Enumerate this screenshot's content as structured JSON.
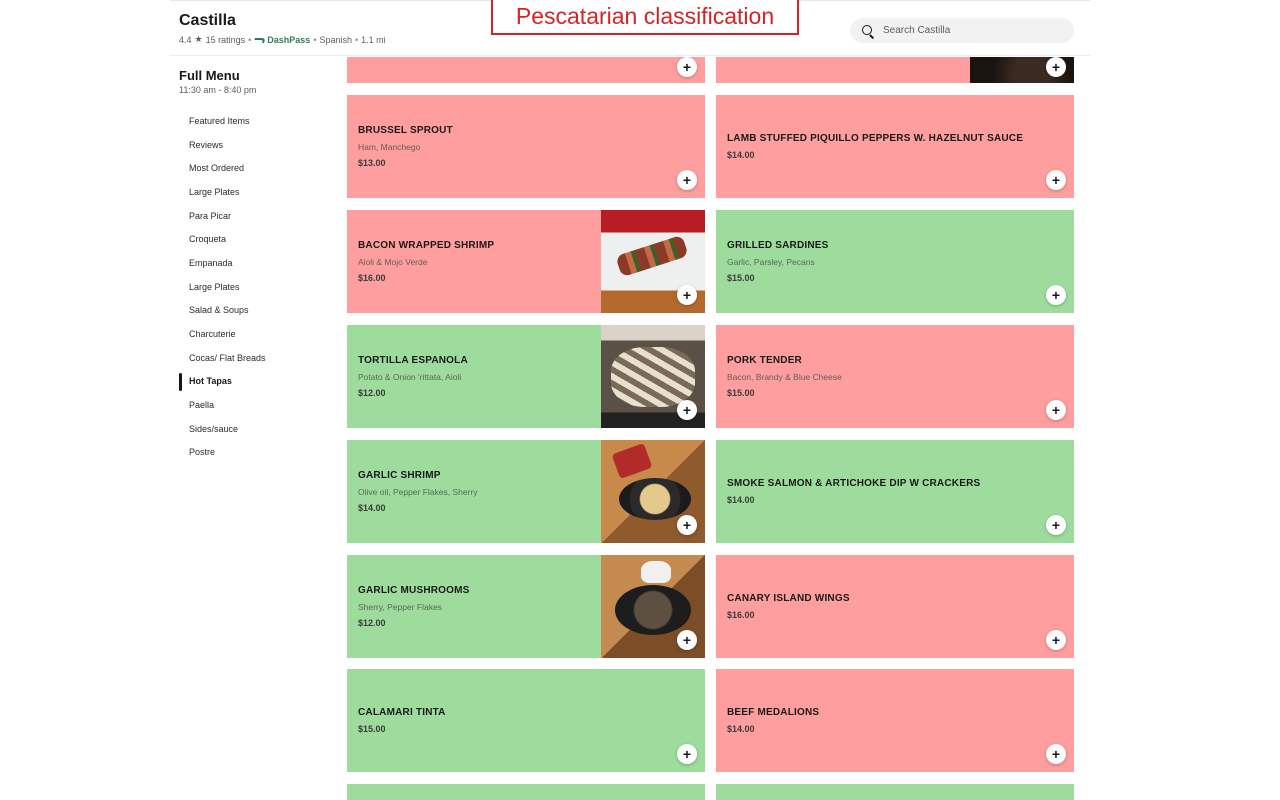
{
  "annotation": "Pescatarian classification",
  "store": {
    "name": "Castilla",
    "rating": "4.4",
    "ratings_count": "15 ratings",
    "dashpass": "DashPass",
    "cuisine": "Spanish",
    "distance": "1.1 mi"
  },
  "search": {
    "placeholder": "Search Castilla"
  },
  "menu": {
    "title": "Full Menu",
    "hours": "11:30 am - 8:40 pm",
    "items": [
      "Featured Items",
      "Reviews",
      "Most Ordered",
      "Large Plates",
      "Para Picar",
      "Croqueta",
      "Empanada",
      "Large Plates",
      "Salad & Soups",
      "Charcuterie",
      "Cocas/ Flat Breads",
      "Hot Tapas",
      "Paella",
      "Sides/sauce",
      "Postre"
    ],
    "active": "Hot Tapas"
  },
  "colors": {
    "non_pescatarian": "#ff9e9e",
    "pescatarian": "#9ddc9d",
    "annotation": "#d42426"
  },
  "cards": {
    "brussel_sprout": {
      "name": "BRUSSEL SPROUT",
      "desc": "Ham, Manchego",
      "price": "$13.00",
      "class": "non-pescatarian"
    },
    "lamb_piquillo": {
      "name": "LAMB STUFFED PIQUILLO PEPPERS W. HAZELNUT SAUCE",
      "price": "$14.00",
      "class": "non-pescatarian"
    },
    "bacon_shrimp": {
      "name": "BACON WRAPPED SHRIMP",
      "desc": "Aioli & Mojo Verde",
      "price": "$16.00",
      "class": "non-pescatarian"
    },
    "grilled_sardines": {
      "name": "GRILLED SARDINES",
      "desc": "Garlic, Parsley, Pecans",
      "price": "$15.00",
      "class": "pescatarian"
    },
    "tortilla_espanola": {
      "name": "TORTILLA ESPANOLA",
      "desc": "Potato & Onion 'rittata, Aioli",
      "price": "$12.00",
      "class": "pescatarian"
    },
    "pork_tender": {
      "name": "PORK TENDER",
      "desc": "Bacon, Brandy & Blue Cheese",
      "price": "$15.00",
      "class": "non-pescatarian"
    },
    "garlic_shrimp": {
      "name": "GARLIC SHRIMP",
      "desc": "Olive oil, Pepper Flakes, Sherry",
      "price": "$14.00",
      "class": "pescatarian"
    },
    "smoke_salmon": {
      "name": "SMOKE SALMON & ARTICHOKE DIP W CRACKERS",
      "price": "$14.00",
      "class": "pescatarian"
    },
    "garlic_mushrooms": {
      "name": "GARLIC MUSHROOMS",
      "desc": "Sherry, Pepper Flakes",
      "price": "$12.00",
      "class": "pescatarian"
    },
    "canary_wings": {
      "name": "CANARY ISLAND WINGS",
      "price": "$16.00",
      "class": "non-pescatarian"
    },
    "calamari_tinta": {
      "name": "CALAMARI TINTA",
      "price": "$15.00",
      "class": "pescatarian"
    },
    "beef_medalions": {
      "name": "BEEF MEDALIONS",
      "price": "$14.00",
      "class": "non-pescatarian"
    }
  },
  "add_label": "+"
}
